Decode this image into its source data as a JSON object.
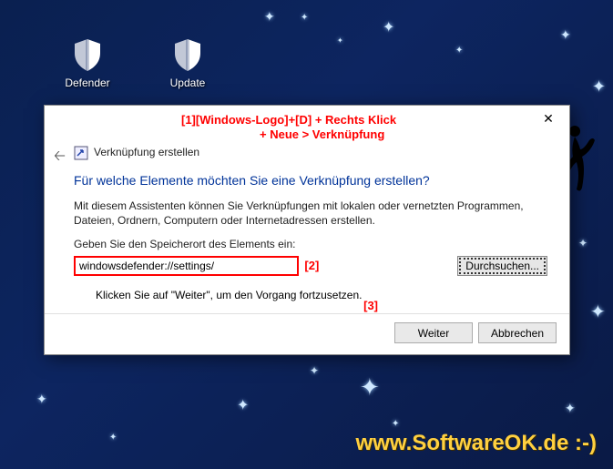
{
  "desktop": {
    "icons": [
      {
        "label": "Defender"
      },
      {
        "label": "Update"
      }
    ]
  },
  "annotations": {
    "line1": "[1][Windows-Logo]+[D] + Rechts Klick",
    "line2": "+ Neue > Verknüpfung",
    "m2": "[2]",
    "m3": "[3]"
  },
  "dialog": {
    "title": "Verknüpfung erstellen",
    "heading": "Für welche Elemente möchten Sie eine Verknüpfung erstellen?",
    "description": "Mit diesem Assistenten können Sie Verknüpfungen mit lokalen oder vernetzten Programmen, Dateien, Ordnern, Computern oder Internetadressen erstellen.",
    "field_label": "Geben Sie den Speicherort des Elements ein:",
    "path_value": "windowsdefender://settings/",
    "browse": "Durchsuchen...",
    "hint": "Klicken Sie auf \"Weiter\", um den Vorgang fortzusetzen.",
    "next": "Weiter",
    "cancel": "Abbrechen"
  },
  "watermark": "www.SoftwareOK.de :-)"
}
